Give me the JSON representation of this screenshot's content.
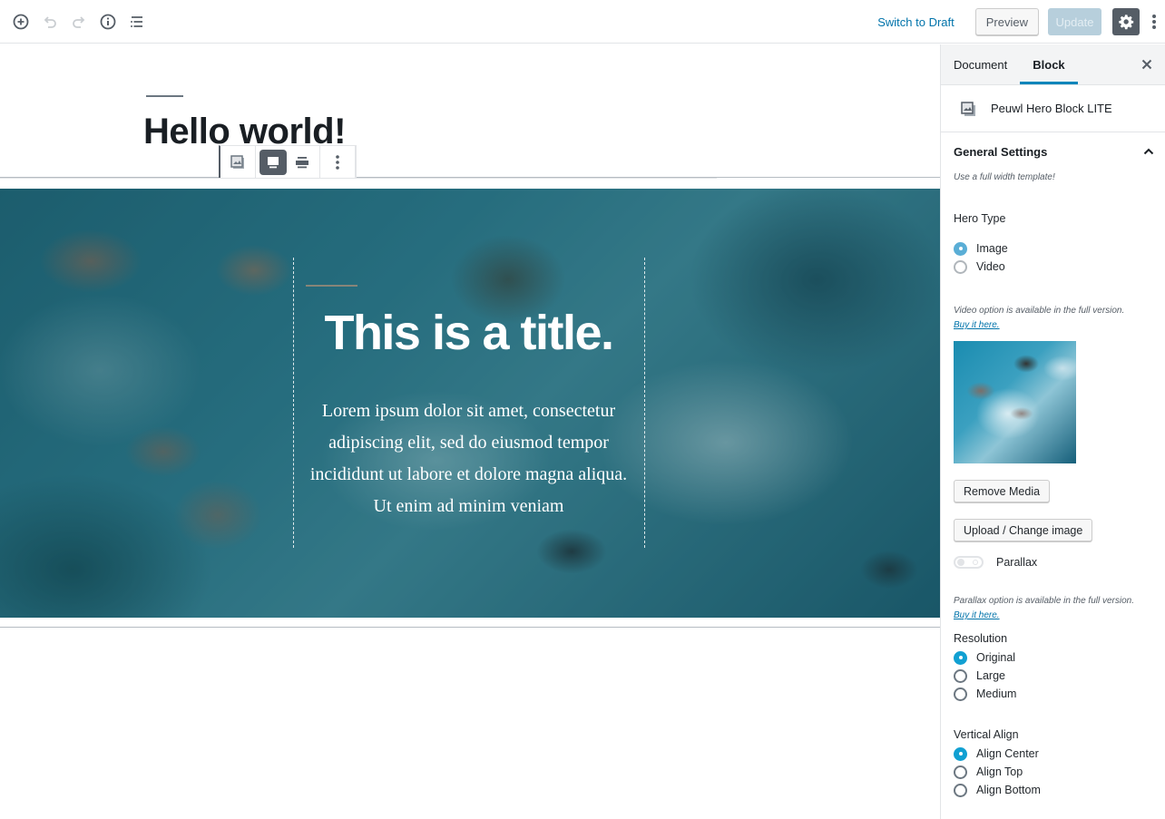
{
  "topbar": {
    "icons": [
      "add-block-icon",
      "undo-icon",
      "redo-icon",
      "info-icon",
      "outline-icon"
    ],
    "switch_to_draft": "Switch to Draft",
    "preview": "Preview",
    "update": "Update",
    "settings_icon": "gear-icon",
    "more_icon": "vertical-ellipsis-icon",
    "colors": {
      "link": "#0073aa",
      "update_disabled": "#b7cfdc",
      "settings_active": "#555d66"
    }
  },
  "editor": {
    "post_title": "Hello world!",
    "block_toolbar": {
      "buttons": [
        "block-type-icon",
        "align-wide-icon",
        "align-full-icon",
        "more-options-icon"
      ],
      "active": "align-wide-icon"
    },
    "hero": {
      "title": "This is a title.",
      "text": "Lorem ipsum dolor sit amet, consectetur adipiscing elit, sed do eiusmod tempor incididunt ut labore et dolore magna aliqua. Ut enim ad minim veniam"
    }
  },
  "sidebar": {
    "tabs": [
      {
        "label": "Document",
        "active": false
      },
      {
        "label": "Block",
        "active": true
      }
    ],
    "block_name": "Peuwl Hero Block LITE",
    "panel_title": "General Settings",
    "full_width_note": "Use a full width template!",
    "hero_type": {
      "label": "Hero Type",
      "options": [
        "Image",
        "Video"
      ],
      "selected": "Image"
    },
    "video_note": "Video option is available in the full version.",
    "buy_link_1": "Buy it here.",
    "remove_media": "Remove Media",
    "upload_change": "Upload / Change image",
    "parallax": {
      "label": "Parallax",
      "enabled": false
    },
    "parallax_note": "Parallax option is available in the full version.",
    "buy_link_2": "Buy it here.",
    "resolution": {
      "label": "Resolution",
      "options": [
        "Original",
        "Large",
        "Medium"
      ],
      "selected": "Original"
    },
    "vertical_align": {
      "label": "Vertical Align",
      "options": [
        "Align Center",
        "Align Top",
        "Align Bottom"
      ],
      "selected": "Align Center"
    },
    "accent_color": "#0085ba"
  }
}
